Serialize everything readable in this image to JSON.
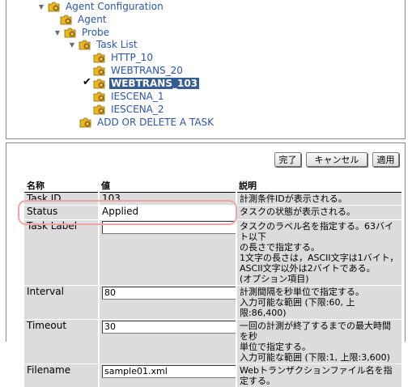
{
  "tree": {
    "nodes": [
      {
        "id": "agent-configuration",
        "label": "Agent Configuration",
        "twisty": "▼",
        "selected": false
      },
      {
        "id": "agent",
        "label": "Agent",
        "twisty": "",
        "selected": false
      },
      {
        "id": "probe",
        "label": "Probe",
        "twisty": "▼",
        "selected": false
      },
      {
        "id": "task-list",
        "label": "Task List",
        "twisty": "▼",
        "selected": false
      },
      {
        "id": "http-10",
        "label": "HTTP_10",
        "twisty": "",
        "selected": false
      },
      {
        "id": "webtrans-20",
        "label": "WEBTRANS_20",
        "twisty": "",
        "selected": false
      },
      {
        "id": "webtrans-103",
        "label": "WEBTRANS_103",
        "twisty": "",
        "selected": true
      },
      {
        "id": "iescena-1",
        "label": "IESCENA_1",
        "twisty": "",
        "selected": false
      },
      {
        "id": "iescena-2",
        "label": "IESCENA_2",
        "twisty": "",
        "selected": false
      },
      {
        "id": "add-or-delete-task",
        "label": "ADD OR DELETE A TASK",
        "twisty": "",
        "selected": false
      }
    ],
    "check_mark": "✔"
  },
  "buttons": {
    "finish": "完了",
    "cancel": "キャンセル",
    "apply": "適用"
  },
  "table": {
    "headers": {
      "name": "名称",
      "value": "値",
      "description": "説明"
    },
    "rows": [
      {
        "name": "Task ID",
        "value": "103",
        "value_type": "text",
        "description": "計測条件IDが表示される。"
      },
      {
        "name": "Status",
        "value": "Applied",
        "value_type": "text",
        "description": "タスクの状態が表示される。"
      },
      {
        "name": "Task Label",
        "value": "",
        "value_type": "input",
        "description": "タスクのラベル名を指定する。63バイト以下\nの長さで指定する。\n1文字の長さは，ASCII文字は1バイト，\nASCII文字以外は2バイトである。\n(オプション項目)"
      },
      {
        "name": "Interval",
        "value": "80",
        "value_type": "input",
        "description": "計測間隔を秒単位で指定する。\n入力可能な範囲 (下限:60, 上限:86,400)"
      },
      {
        "name": "Timeout",
        "value": "30",
        "value_type": "input",
        "description": "一回の計測が終了するまでの最大時間を秒\n単位で指定する。\n入力可能な範囲 (下限:1, 上限:3,600)"
      },
      {
        "name": "Filename",
        "value": "sample01.xml",
        "value_type": "input",
        "description": "Webトランザクションファイル名を指定する。"
      }
    ]
  },
  "colors": {
    "link": "#2a55b3",
    "selected_bg": "#355d94",
    "table_cell_bg": "#dcdcdc",
    "highlight": "#f2a4a4"
  }
}
